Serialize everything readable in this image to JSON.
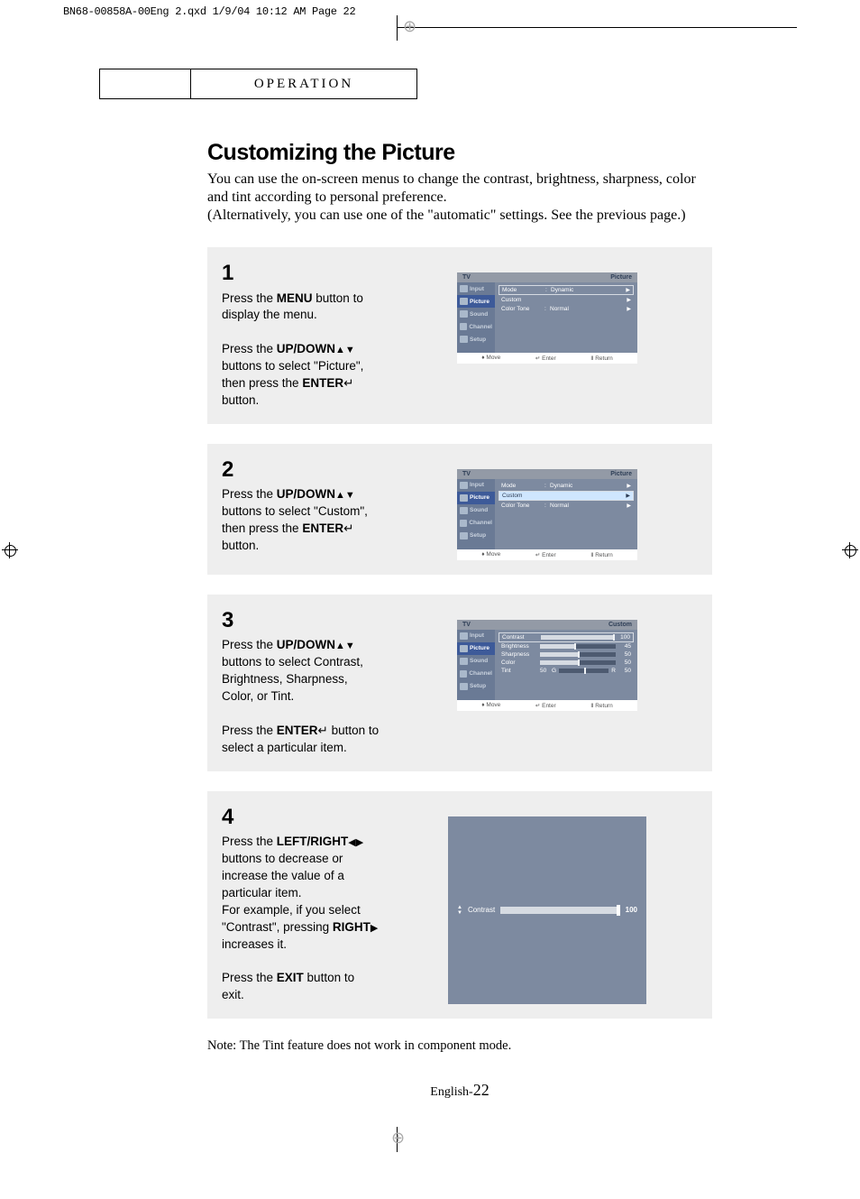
{
  "header": {
    "printer_line": "BN68-00858A-00Eng 2.qxd  1/9/04 10:12 AM  Page 22",
    "section": "OPERATION"
  },
  "title": "Customizing the Picture",
  "subtitle_l1": "You can use the on-screen menus to change the contrast, brightness, sharpness, color and tint according to personal preference.",
  "subtitle_l2": "(Alternatively, you can use one of the \"automatic\" settings. See the previous page.)",
  "steps": {
    "s1": {
      "num": "1",
      "txt_a": "Press the ",
      "txt_b": "MENU",
      "txt_c": " button to display the menu.",
      "txt2_a": "Press the ",
      "txt2_b": "UP/DOWN",
      "txt2_arr": "▲▼",
      "txt2_c": " buttons to select \"Picture\", then press the ",
      "txt2_d": "ENTER",
      "txt2_icon": "↵",
      "txt2_e": " button."
    },
    "s2": {
      "num": "2",
      "txt_a": "Press the ",
      "txt_b": "UP/DOWN",
      "txt_arr": "▲▼",
      "txt_c": " buttons to select \"Custom\", then press the ",
      "txt_d": "ENTER",
      "txt_icon": "↵",
      "txt_e": " button."
    },
    "s3": {
      "num": "3",
      "txt_a": "Press the ",
      "txt_b": "UP/DOWN",
      "txt_arr": "▲▼",
      "txt_c": " buttons to select Contrast, Brightness, Sharpness, Color, or Tint.",
      "txt2_a": "Press the ",
      "txt2_b": "ENTER",
      "txt2_icon": "↵",
      "txt2_c": " button to select a particular item."
    },
    "s4": {
      "num": "4",
      "txt_a": "Press the ",
      "txt_b": "LEFT/RIGHT",
      "txt_arr": "◀▶",
      "txt_c": " buttons to decrease or increase the value of a particular item.",
      "txt2": "For example, if you select \"Contrast\", pressing ",
      "txt2b": "RIGHT",
      "txt2arr": "▶",
      "txt2c": " increases it.",
      "txt3_a": "Press the ",
      "txt3_b": "EXIT",
      "txt3_c": " button to exit."
    }
  },
  "osd_common": {
    "tv": "TV",
    "side": {
      "input": "Input",
      "picture": "Picture",
      "sound": "Sound",
      "channel": "Channel",
      "setup": "Setup"
    },
    "foot": {
      "move": "Move",
      "enter": "Enter",
      "return": "Return"
    },
    "arrow": "▶",
    "udarrow": "♦",
    "entersym": "↵",
    "retsym": "Ⅱ"
  },
  "osd1": {
    "title": "Picture",
    "rows": {
      "mode": {
        "l": "Mode",
        "c": ":",
        "v": "Dynamic"
      },
      "custom": {
        "l": "Custom"
      },
      "colortone": {
        "l": "Color Tone",
        "c": ":",
        "v": "Normal"
      }
    }
  },
  "osd2": {
    "title": "Picture"
  },
  "osd3": {
    "title": "Custom",
    "items": {
      "contrast": {
        "l": "Contrast",
        "v": "100",
        "pct": 100
      },
      "brightness": {
        "l": "Brightness",
        "v": "45",
        "pct": 45
      },
      "sharpness": {
        "l": "Sharpness",
        "v": "50",
        "pct": 50
      },
      "color": {
        "l": "Color",
        "v": "50",
        "pct": 50
      },
      "tint": {
        "l": "Tint",
        "g": "50",
        "gl": "G",
        "rl": "R",
        "v": "50",
        "pct": 50
      }
    }
  },
  "osd4": {
    "label": "Contrast",
    "value": "100",
    "up": "▲",
    "down": "▼"
  },
  "note": "Note: The Tint feature does not work in component mode.",
  "page": {
    "prefix": "English-",
    "num": "22"
  }
}
